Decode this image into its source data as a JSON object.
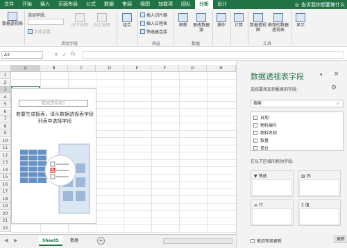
{
  "tabs": [
    "文件",
    "开始",
    "插入",
    "页面布局",
    "公式",
    "数据",
    "审阅",
    "视图",
    "加载项",
    "团队",
    "分析",
    "设计"
  ],
  "active_tab": "分析",
  "tell_me": "告诉我你想要做什么",
  "ribbon": {
    "pivot_table": "数据透视表",
    "active_field_label": "活动字段:",
    "field_settings": "字段设置",
    "drill_down": "向下钻取",
    "drill_up": "向上钻取",
    "group_active_field": "活动字段",
    "group": "组合",
    "insert_slicer": "插入切片器",
    "insert_timeline": "插入日程表",
    "filter_connections": "筛选器连接",
    "group_filter": "筛选",
    "refresh": "刷新",
    "change_source": "更改数据源",
    "group_data": "数据",
    "actions": "操作",
    "calculations": "计算",
    "pivot_chart": "数据透视图",
    "recommended": "推荐的数据透视表",
    "show": "显示",
    "group_tools": "工具"
  },
  "namebox": "A3",
  "columns": [
    "A",
    "B",
    "C",
    "D",
    "E",
    "F",
    "G",
    "H"
  ],
  "rows": [
    "1",
    "2",
    "3",
    "4",
    "5",
    "6",
    "7",
    "8",
    "9",
    "10",
    "11",
    "12",
    "13",
    "14",
    "15",
    "16",
    "17",
    "18",
    "19",
    "20",
    "21",
    "22"
  ],
  "pivot": {
    "title": "数据透视表5",
    "hint": "若要生成报表，请从数据透视表字段列表中选择字段"
  },
  "sheets": [
    "Sheet5",
    "数据"
  ],
  "active_sheet": "Sheet5",
  "pane": {
    "title": "数据透视表字段",
    "subtitle": "选择要添加到报表的字段:",
    "search_placeholder": "搜索",
    "fields": [
      "日期",
      "物料编号",
      "物料名称",
      "数量",
      "单价"
    ],
    "drag_hint": "在以下区域间拖动字段:",
    "areas": [
      "筛选",
      "列",
      "行",
      "值"
    ],
    "defer": "推迟布局更新",
    "update": "更新"
  },
  "colors": {
    "accent": "#217346",
    "brand_green": "#217346"
  }
}
